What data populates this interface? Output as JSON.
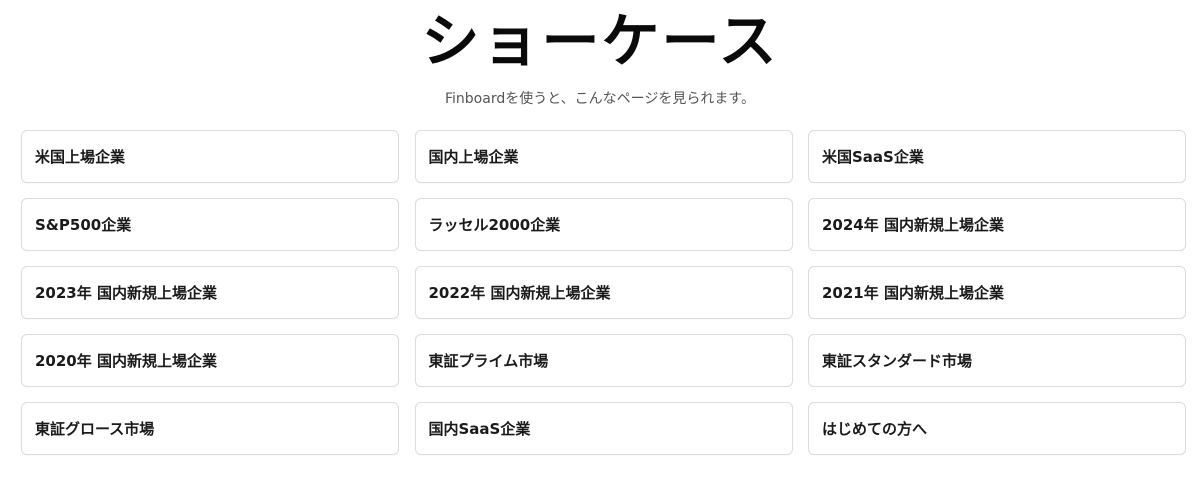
{
  "header": {
    "title": "ショーケース",
    "subtitle": "Finboardを使うと、こんなページを見られます。"
  },
  "showcase": {
    "items": [
      {
        "label": "米国上場企業"
      },
      {
        "label": "国内上場企業"
      },
      {
        "label": "米国SaaS企業"
      },
      {
        "label": "S&P500企業"
      },
      {
        "label": "ラッセル2000企業"
      },
      {
        "label": "2024年 国内新規上場企業"
      },
      {
        "label": "2023年 国内新規上場企業"
      },
      {
        "label": "2022年 国内新規上場企業"
      },
      {
        "label": "2021年 国内新規上場企業"
      },
      {
        "label": "2020年 国内新規上場企業"
      },
      {
        "label": "東証プライム市場"
      },
      {
        "label": "東証スタンダード市場"
      },
      {
        "label": "東証グロース市場"
      },
      {
        "label": "国内SaaS企業"
      },
      {
        "label": "はじめての方へ"
      }
    ]
  },
  "colors": {
    "background": "#ffffff",
    "card_border": "#dcdcdc",
    "text": "#1a1a1a",
    "subtitle": "#555555"
  }
}
